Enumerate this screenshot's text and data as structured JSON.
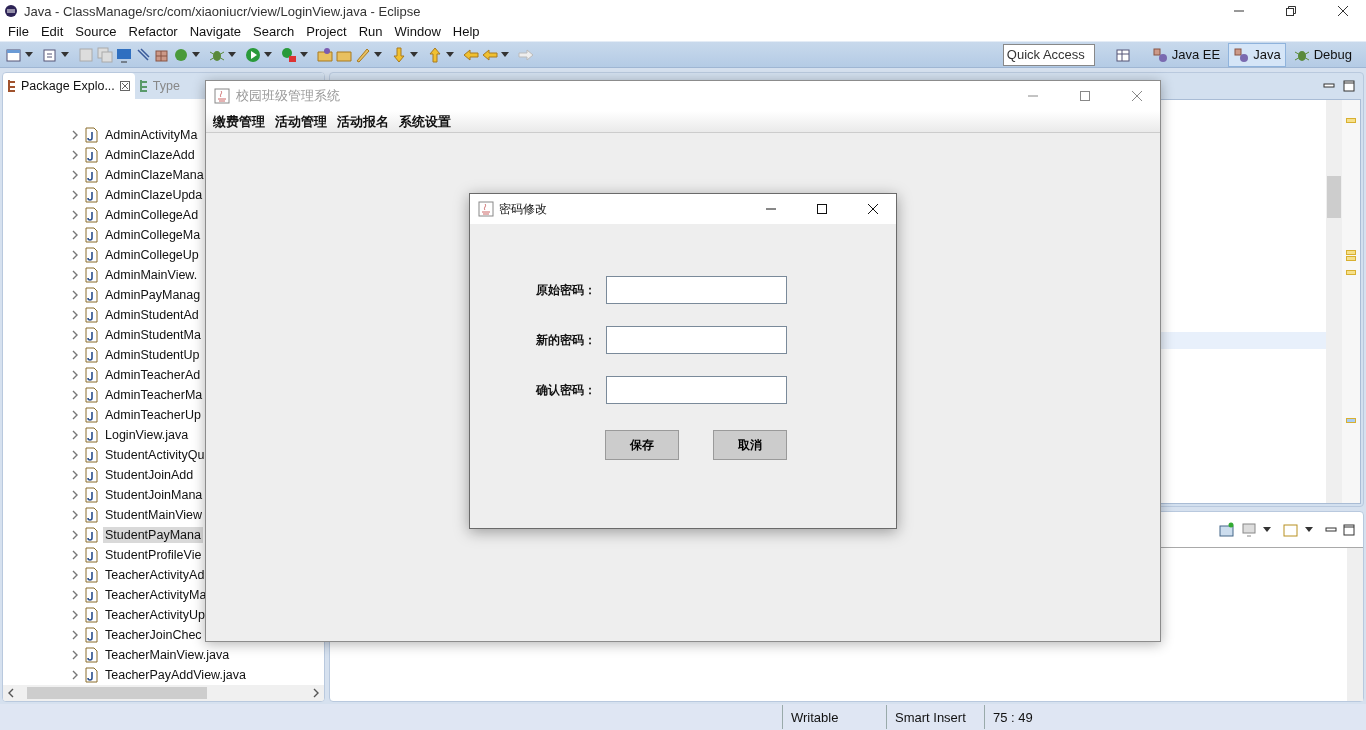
{
  "eclipse": {
    "title": "Java - ClassManage/src/com/xiaoniucr/view/LoginView.java - Eclipse",
    "menu": [
      "File",
      "Edit",
      "Source",
      "Refactor",
      "Navigate",
      "Search",
      "Project",
      "Run",
      "Window",
      "Help"
    ],
    "quick_access": {
      "placeholder": "Quick Access"
    },
    "perspectives": [
      {
        "label": "Java EE",
        "selected": false
      },
      {
        "label": "Java",
        "selected": true
      },
      {
        "label": "Debug",
        "selected": false
      }
    ],
    "views": [
      {
        "label": "Package Explo...",
        "selected": true
      },
      {
        "label": "Type",
        "selected": false
      }
    ],
    "tree": [
      {
        "label": "AdminActivityMa",
        "selected": false
      },
      {
        "label": "AdminClazeAdd",
        "selected": false
      },
      {
        "label": "AdminClazeMana",
        "selected": false
      },
      {
        "label": "AdminClazeUpda",
        "selected": false
      },
      {
        "label": "AdminCollegeAd",
        "selected": false
      },
      {
        "label": "AdminCollegeMa",
        "selected": false
      },
      {
        "label": "AdminCollegeUp",
        "selected": false
      },
      {
        "label": "AdminMainView.",
        "selected": false
      },
      {
        "label": "AdminPayManag",
        "selected": false
      },
      {
        "label": "AdminStudentAd",
        "selected": false
      },
      {
        "label": "AdminStudentMa",
        "selected": false
      },
      {
        "label": "AdminStudentUp",
        "selected": false
      },
      {
        "label": "AdminTeacherAd",
        "selected": false
      },
      {
        "label": "AdminTeacherMa",
        "selected": false
      },
      {
        "label": "AdminTeacherUp",
        "selected": false
      },
      {
        "label": "LoginView.java",
        "selected": false
      },
      {
        "label": "StudentActivityQu",
        "selected": false
      },
      {
        "label": "StudentJoinAdd",
        "selected": false
      },
      {
        "label": "StudentJoinMana",
        "selected": false
      },
      {
        "label": "StudentMainView",
        "selected": false
      },
      {
        "label": "StudentPayMana",
        "selected": true
      },
      {
        "label": "StudentProfileVie",
        "selected": false
      },
      {
        "label": "TeacherActivityAd",
        "selected": false
      },
      {
        "label": "TeacherActivityMa",
        "selected": false
      },
      {
        "label": "TeacherActivityUp",
        "selected": false
      },
      {
        "label": "TeacherJoinChec",
        "selected": false
      },
      {
        "label": "TeacherMainView.java",
        "selected": false
      },
      {
        "label": "TeacherPayAddView.java",
        "selected": false
      }
    ],
    "status_bar": [
      "Writable",
      "Smart Insert",
      "75 : 49"
    ]
  },
  "app_window": {
    "title": "校园班级管理系统",
    "menu": [
      "缴费管理",
      "活动管理",
      "活动报名",
      "系统设置"
    ]
  },
  "dialog": {
    "title": "密码修改",
    "fields": [
      {
        "label": "原始密码："
      },
      {
        "label": "新的密码："
      },
      {
        "label": "确认密码："
      }
    ],
    "buttons": [
      "保存",
      "取消"
    ]
  }
}
